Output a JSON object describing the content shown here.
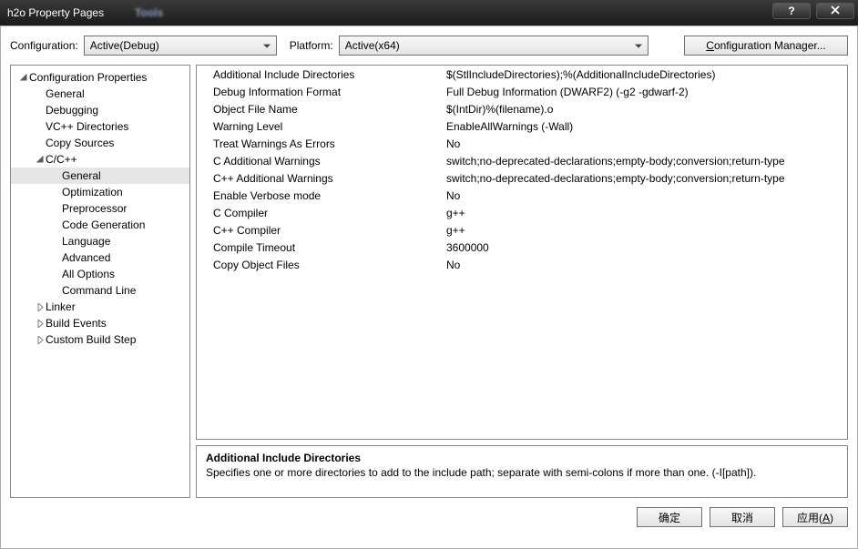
{
  "window": {
    "title": "h2o Property Pages",
    "blurred_tab": "Tools"
  },
  "toolbar": {
    "config_label": "Configuration:",
    "config_value": "Active(Debug)",
    "platform_label": "Platform:",
    "platform_value": "Active(x64)",
    "config_manager": "Configuration Manager..."
  },
  "tree": {
    "root": "Configuration Properties",
    "items_l2": [
      "General",
      "Debugging",
      "VC++ Directories",
      "Copy Sources"
    ],
    "cpp_node": "C/C++",
    "cpp_children": [
      "General",
      "Optimization",
      "Preprocessor",
      "Code Generation",
      "Language",
      "Advanced",
      "All Options",
      "Command Line"
    ],
    "tail_l2": [
      "Linker",
      "Build Events",
      "Custom Build Step"
    ],
    "selected": "General"
  },
  "props": [
    {
      "k": "Additional Include Directories",
      "v": "$(StlIncludeDirectories);%(AdditionalIncludeDirectories)"
    },
    {
      "k": "Debug Information Format",
      "v": "Full Debug Information (DWARF2) (-g2 -gdwarf-2)"
    },
    {
      "k": "Object File Name",
      "v": "$(IntDir)%(filename).o"
    },
    {
      "k": "Warning Level",
      "v": "EnableAllWarnings (-Wall)"
    },
    {
      "k": "Treat Warnings As Errors",
      "v": "No"
    },
    {
      "k": "C Additional Warnings",
      "v": "switch;no-deprecated-declarations;empty-body;conversion;return-type"
    },
    {
      "k": "C++ Additional Warnings",
      "v": "switch;no-deprecated-declarations;empty-body;conversion;return-type"
    },
    {
      "k": "Enable Verbose mode",
      "v": "No"
    },
    {
      "k": "C Compiler",
      "v": "g++"
    },
    {
      "k": "C++ Compiler",
      "v": "g++"
    },
    {
      "k": "Compile Timeout",
      "v": "3600000"
    },
    {
      "k": "Copy Object Files",
      "v": "No"
    }
  ],
  "description": {
    "heading": "Additional Include Directories",
    "body": "Specifies one or more directories to add to the include path; separate with semi-colons if more than one. (-I[path])."
  },
  "footer": {
    "ok": "确定",
    "cancel": "取消",
    "apply_prefix": "应用(",
    "apply_letter": "A",
    "apply_suffix": ")"
  },
  "config_mgr_underline": "C"
}
